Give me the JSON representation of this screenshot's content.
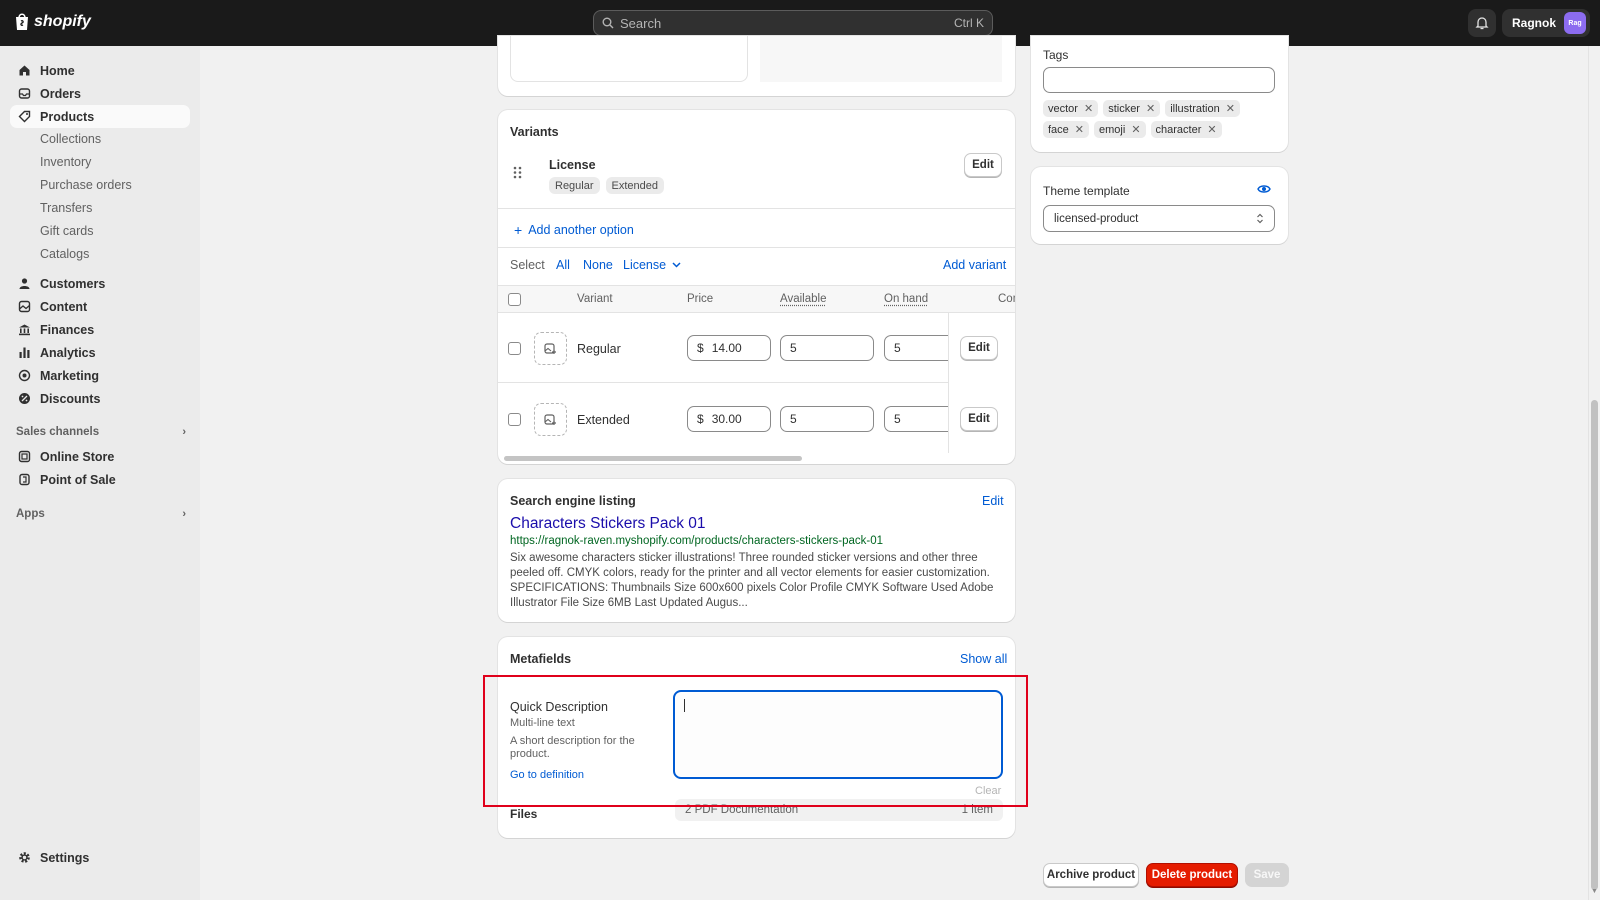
{
  "app": {
    "brand": "shopify"
  },
  "topbar": {
    "search_placeholder": "Search",
    "search_shortcut": "Ctrl K",
    "user_name": "Ragnok",
    "user_initials": "Rag"
  },
  "sidebar": {
    "items": [
      {
        "label": "Home",
        "icon": "home-icon"
      },
      {
        "label": "Orders",
        "icon": "orders-icon"
      },
      {
        "label": "Products",
        "icon": "tag-icon",
        "active": true
      }
    ],
    "product_sub": [
      "Collections",
      "Inventory",
      "Purchase orders",
      "Transfers",
      "Gift cards",
      "Catalogs"
    ],
    "items2": [
      {
        "label": "Customers",
        "icon": "person-icon"
      },
      {
        "label": "Content",
        "icon": "content-icon"
      },
      {
        "label": "Finances",
        "icon": "bank-icon"
      },
      {
        "label": "Analytics",
        "icon": "bar-chart-icon"
      },
      {
        "label": "Marketing",
        "icon": "target-icon"
      },
      {
        "label": "Discounts",
        "icon": "discount-icon"
      }
    ],
    "sales_channels_label": "Sales channels",
    "channels": [
      {
        "label": "Online Store",
        "icon": "store-icon"
      },
      {
        "label": "Point of Sale",
        "icon": "pos-icon"
      }
    ],
    "apps_label": "Apps",
    "settings_label": "Settings"
  },
  "variants": {
    "title": "Variants",
    "option_name": "License",
    "option_values": [
      "Regular",
      "Extended"
    ],
    "edit_label": "Edit",
    "add_option_label": "Add another option",
    "select_label": "Select",
    "select_all": "All",
    "select_none": "None",
    "select_license": "License",
    "add_variant_label": "Add variant",
    "columns": {
      "variant": "Variant",
      "price": "Price",
      "available": "Available",
      "on_hand": "On hand",
      "committed": "Com"
    },
    "rows": [
      {
        "name": "Regular",
        "currency": "$",
        "price": "14.00",
        "available": "5",
        "on_hand": "5",
        "edit": "Edit"
      },
      {
        "name": "Extended",
        "currency": "$",
        "price": "30.00",
        "available": "5",
        "on_hand": "5",
        "edit": "Edit"
      }
    ]
  },
  "seo": {
    "title": "Search engine listing",
    "edit_label": "Edit",
    "page_title": "Characters Stickers Pack 01",
    "url": "https://ragnok-raven.myshopify.com/products/characters-stickers-pack-01",
    "description": "Six awesome characters sticker illustrations! Three rounded sticker versions and other three peeled off. CMYK colors, ready for the printer and all vector elements for easier customization. SPECIFICATIONS: Thumbnails Size 600x600 pixels Color Profile CMYK Software Used Adobe Illustrator File Size 6MB Last Updated Augus..."
  },
  "metafields": {
    "title": "Metafields",
    "show_all": "Show all",
    "field_name": "Quick Description",
    "field_type": "Multi-line text",
    "field_desc": "A short description for the product.",
    "go_to_definition": "Go to definition",
    "value": "",
    "clear_label": "Clear",
    "files_label": "Files",
    "files_value": "2 PDF Documentation",
    "files_count": "1 item"
  },
  "tags": {
    "title": "Tags",
    "input_value": "",
    "items": [
      "vector",
      "sticker",
      "illustration",
      "face",
      "emoji",
      "character"
    ]
  },
  "theme": {
    "title": "Theme template",
    "value": "licensed-product"
  },
  "footer": {
    "archive_label": "Archive product",
    "delete_label": "Delete product",
    "save_label": "Save"
  },
  "colors": {
    "accent": "#005bd3",
    "danger": "#e51c00",
    "highlight": "#e0001b",
    "topbar": "#1a1a1a"
  }
}
